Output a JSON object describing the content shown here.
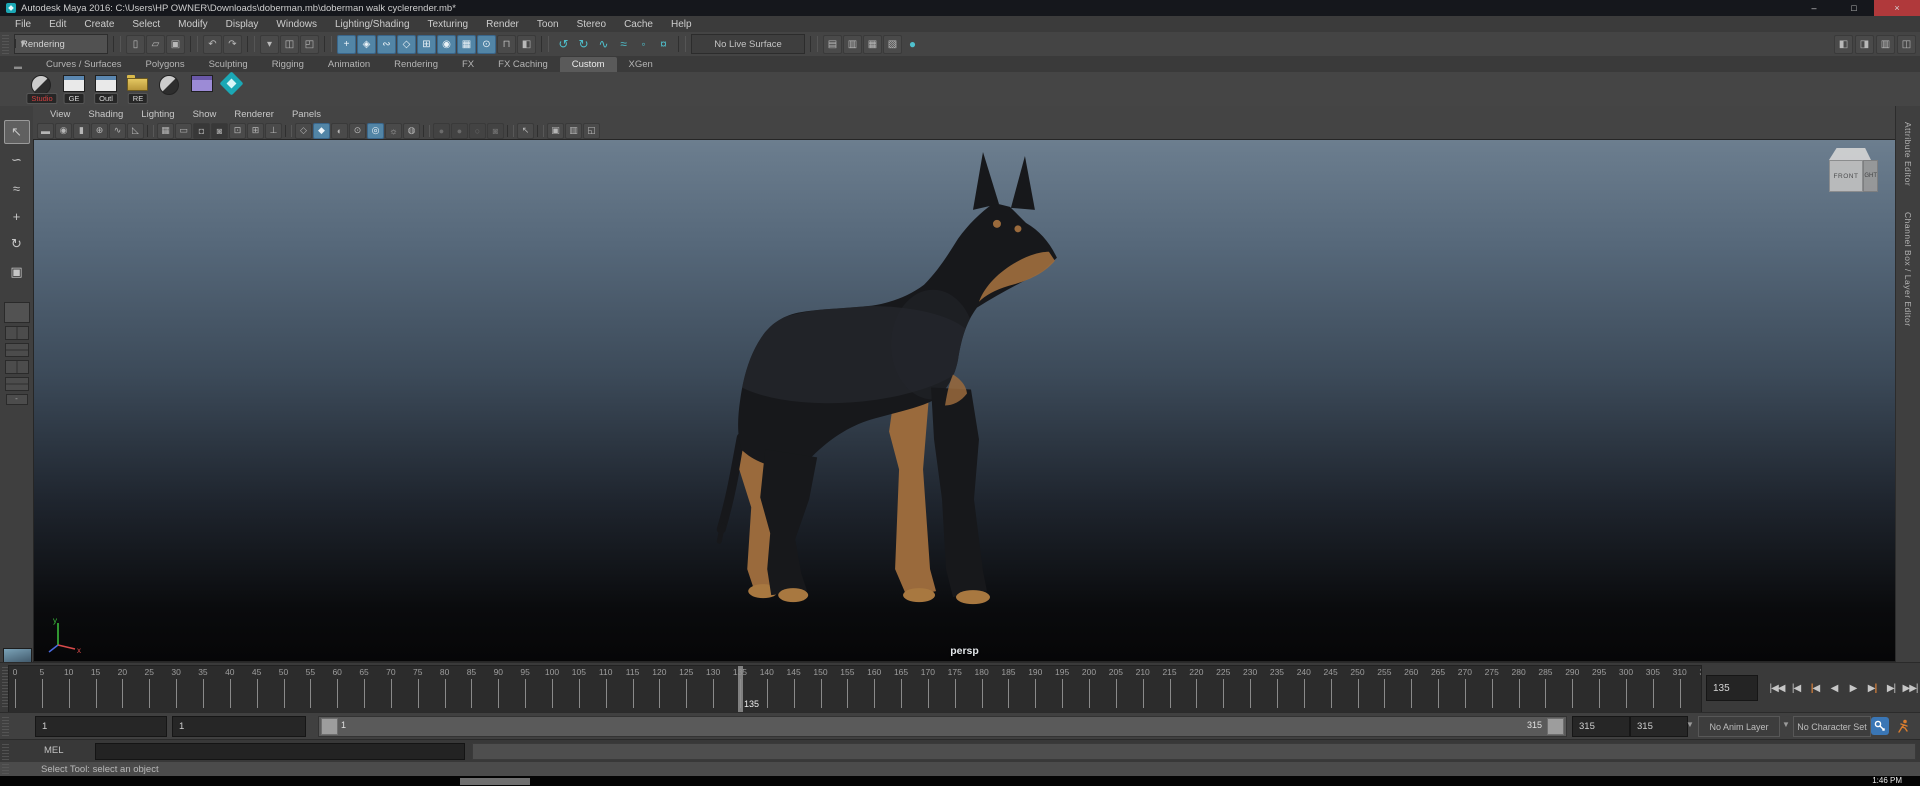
{
  "window": {
    "title": "Autodesk Maya 2016: C:\\Users\\HP OWNER\\Downloads\\doberman.mb\\doberman walk cyclerender.mb*",
    "controls": {
      "minimize": "–",
      "maximize": "□",
      "close": "×"
    }
  },
  "menu_bar": [
    "File",
    "Edit",
    "Create",
    "Select",
    "Modify",
    "Display",
    "Windows",
    "Lighting/Shading",
    "Texturing",
    "Render",
    "Toon",
    "Stereo",
    "Cache",
    "Help"
  ],
  "status_line": {
    "menu_set": "Rendering",
    "live_surface": "No Live Surface",
    "icon_groups": [
      {
        "name": "file-group",
        "items": [
          {
            "n": "new-scene-icon",
            "g": "▯"
          },
          {
            "n": "open-scene-icon",
            "g": "▱"
          },
          {
            "n": "save-scene-icon",
            "g": "▣"
          }
        ]
      },
      {
        "name": "undo-group",
        "items": [
          {
            "n": "undo-icon",
            "g": "↶"
          },
          {
            "n": "redo-icon",
            "g": "↷"
          }
        ]
      },
      {
        "name": "selection-mask-group",
        "items": [
          {
            "n": "selection-mode-caret-icon",
            "g": "▾"
          },
          {
            "n": "hierarchy-mode-icon",
            "g": "◫"
          },
          {
            "n": "object-mode-icon",
            "g": "◰"
          }
        ]
      },
      {
        "name": "snap-group",
        "items": [
          {
            "n": "snap-grid-icon",
            "g": "+",
            "s": "b"
          },
          {
            "n": "snap-curve-icon",
            "g": "◈",
            "s": "b"
          },
          {
            "n": "snap-point-icon",
            "g": "∾",
            "s": "b"
          },
          {
            "n": "snap-plane-icon",
            "g": "◇",
            "s": "b"
          },
          {
            "n": "snap-view-icon",
            "g": "⊞",
            "s": "b"
          },
          {
            "n": "snap-center-icon",
            "g": "◉",
            "s": "b"
          },
          {
            "n": "make-live-icon",
            "g": "▦",
            "s": "b"
          },
          {
            "n": "snap-release-icon",
            "g": "⊙",
            "s": "b"
          },
          {
            "n": "lock-icon",
            "g": "⊓"
          },
          {
            "n": "highlight-selection-icon",
            "g": "◧"
          }
        ]
      },
      {
        "name": "construction-group",
        "items": [
          {
            "n": "construction-history-icon",
            "g": "↺",
            "s": "t"
          },
          {
            "n": "construction-history-off-icon",
            "g": "↻",
            "s": "t"
          },
          {
            "n": "curve-history-icon",
            "g": "∿",
            "s": "t"
          },
          {
            "n": "surface-history-icon",
            "g": "≈",
            "s": "t"
          },
          {
            "n": "point-history-icon",
            "g": "◦",
            "s": "t"
          },
          {
            "n": "texture-history-icon",
            "g": "¤",
            "s": "t"
          }
        ]
      }
    ],
    "render_group": [
      {
        "n": "open-render-view-icon",
        "g": "▤"
      },
      {
        "n": "render-current-frame-icon",
        "g": "▥"
      },
      {
        "n": "ipr-render-icon",
        "g": "▦"
      },
      {
        "n": "render-settings-icon",
        "g": "▧"
      },
      {
        "n": "render-sphere-icon",
        "g": "●",
        "s": "t"
      }
    ],
    "right_toggles": [
      {
        "n": "sidebar-attribute-editor-icon",
        "g": "◧"
      },
      {
        "n": "sidebar-tool-settings-icon",
        "g": "◨"
      },
      {
        "n": "sidebar-channel-box-icon",
        "g": "▥"
      },
      {
        "n": "workspace-icon",
        "g": "◫"
      }
    ]
  },
  "shelf": {
    "tabs": [
      "Curves / Surfaces",
      "Polygons",
      "Sculpting",
      "Rigging",
      "Animation",
      "Rendering",
      "FX",
      "FX Caching",
      "Custom",
      "XGen"
    ],
    "active_tab": "Custom",
    "items": [
      {
        "type": "python",
        "label": "Studio",
        "label_style": "red",
        "n": "shelf-item-studio"
      },
      {
        "type": "window",
        "label": "GE",
        "n": "shelf-item-ge"
      },
      {
        "type": "window",
        "label": "Outl",
        "n": "shelf-item-outl"
      },
      {
        "type": "folder",
        "label": "RE",
        "n": "shelf-item-re"
      },
      {
        "type": "python",
        "label": "",
        "n": "shelf-item-python-script"
      },
      {
        "type": "window-purple",
        "label": "",
        "n": "shelf-item-editor"
      },
      {
        "type": "maya",
        "label": "",
        "n": "shelf-item-maya"
      }
    ]
  },
  "panel_menu": [
    "View",
    "Shading",
    "Lighting",
    "Show",
    "Renderer",
    "Panels"
  ],
  "panel_toolbar": [
    {
      "g": "▬",
      "n": "select-camera-icon"
    },
    {
      "g": "◉",
      "n": "camera-attributes-icon"
    },
    {
      "g": "▮",
      "n": "bookmark-icon"
    },
    {
      "g": "⊕",
      "n": "image-plane-icon"
    },
    {
      "g": "∿",
      "n": "2d-pan-zoom-icon"
    },
    {
      "g": "◺",
      "n": "grease-pencil-icon"
    },
    {
      "sep": true
    },
    {
      "g": "▦",
      "n": "grid-icon"
    },
    {
      "g": "▭",
      "n": "film-gate-icon"
    },
    {
      "g": "◘",
      "n": "resolution-gate-icon",
      "s": "p"
    },
    {
      "g": "◙",
      "n": "gate-mask-icon",
      "s": "p"
    },
    {
      "g": "⊡",
      "n": "field-chart-icon"
    },
    {
      "g": "⊞",
      "n": "safe-action-icon"
    },
    {
      "g": "⊥",
      "n": "safe-title-icon"
    },
    {
      "sep": true
    },
    {
      "g": "◇",
      "n": "wireframe-icon"
    },
    {
      "g": "◆",
      "n": "shaded-mode-icon",
      "s": "a"
    },
    {
      "g": "◐",
      "n": "textured-mode-icon"
    },
    {
      "g": "⊙",
      "n": "use-all-lights-icon"
    },
    {
      "g": "◎",
      "n": "shadows-icon",
      "s": "a"
    },
    {
      "g": "☼",
      "n": "screen-space-ao-icon"
    },
    {
      "g": "◍",
      "n": "motion-blur-icon"
    },
    {
      "sep": true
    },
    {
      "g": "●",
      "n": "multisample-icon",
      "s": "d"
    },
    {
      "g": "●",
      "n": "depth-peeling-icon",
      "s": "d"
    },
    {
      "g": "○",
      "n": "in-viewport-effects-icon",
      "s": "d"
    },
    {
      "g": "◙",
      "n": "viewport-renderer-icon",
      "s": "d"
    },
    {
      "sep": true
    },
    {
      "g": "↖",
      "n": "isolate-select-icon"
    },
    {
      "sep": true
    },
    {
      "g": "▣",
      "n": "single-pane-layout-icon"
    },
    {
      "g": "▥",
      "n": "two-pane-layout-icon"
    },
    {
      "g": "◱",
      "n": "four-pane-layout-icon"
    }
  ],
  "toolbox": [
    {
      "n": "select-tool",
      "g": "↖",
      "active": true
    },
    {
      "n": "lasso-select-tool",
      "g": "∽"
    },
    {
      "n": "paint-select-tool",
      "g": "≈"
    },
    {
      "n": "move-tool",
      "g": "+"
    },
    {
      "n": "rotate-tool",
      "g": "↻"
    },
    {
      "n": "scale-tool",
      "g": "▣"
    }
  ],
  "viewport": {
    "camera_label": "persp",
    "viewcube": {
      "front": "FRONT",
      "right": "RIGHT"
    },
    "axis": {
      "x": "x",
      "y": "y"
    },
    "colors": {
      "sky_top": "#6c7e8f",
      "ground": "#0a0b0d",
      "dog_body": "#17181b",
      "dog_tan": "#9a6a3c",
      "dog_tan_light": "#a87840"
    }
  },
  "timeline": {
    "start": 0,
    "end": 315,
    "label_step": 5,
    "current_frame": 135
  },
  "playback": {
    "current_frame_field": "135",
    "buttons": [
      {
        "n": "go-to-start-button",
        "g": "|◀◀"
      },
      {
        "n": "step-back-frame-button",
        "g": "|◀"
      },
      {
        "n": "step-back-key-button",
        "g": "|◀",
        "key": true
      },
      {
        "n": "play-backwards-button",
        "g": "◀"
      },
      {
        "n": "play-forwards-button",
        "g": "▶"
      },
      {
        "n": "step-forward-key-button",
        "g": "▶|",
        "key": true
      },
      {
        "n": "step-forward-frame-button",
        "g": "▶|"
      },
      {
        "n": "go-to-end-button",
        "g": "▶▶|"
      }
    ]
  },
  "range": {
    "playback_start": "1",
    "anim_start": "1",
    "bar_start_label": "1",
    "bar_end_label": "315",
    "anim_end": "315",
    "playback_end": "315",
    "anim_layer": "No Anim Layer",
    "character_set": "No Character Set"
  },
  "command_line": {
    "label": "MEL"
  },
  "help_line": {
    "text": "Select Tool: select an object"
  },
  "taskbar": {
    "clock": "1:46 PM"
  },
  "sidebar": {
    "tabs": [
      "Attribute Editor",
      "Channel Box / Layer Editor"
    ]
  }
}
